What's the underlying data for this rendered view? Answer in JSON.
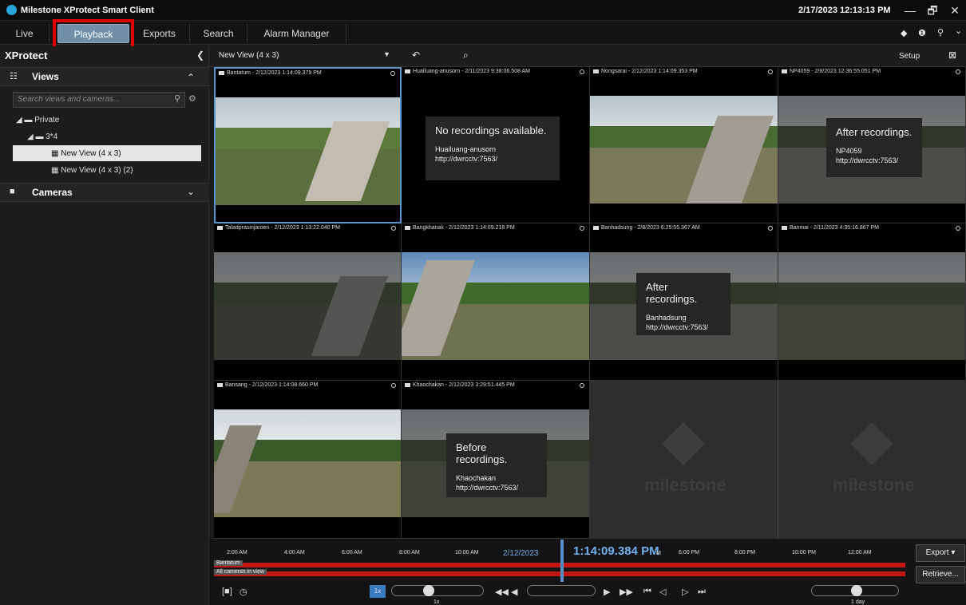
{
  "app": {
    "title": "Milestone XProtect Smart Client",
    "clock": "2/17/2023 12:13:13 PM",
    "win": [
      "—",
      "🗗",
      "✕"
    ]
  },
  "tabs": [
    "Live",
    "Playback",
    "Exports",
    "Search",
    "Alarm Manager"
  ],
  "header_icons": [
    "◆",
    "❶",
    "⚲",
    "⌄"
  ],
  "sidebar": {
    "title": "XProtect",
    "views_label": "Views",
    "search_placeholder": "Search views and cameras...",
    "tree": [
      "Private",
      "3*4",
      "New View (4 x 3)",
      "New View (4 x 3) (2)"
    ],
    "cameras_label": "Cameras"
  },
  "view_toolbar": {
    "view_name": "New View (4 x 3)",
    "setup": "Setup"
  },
  "tiles": [
    {
      "head": "Bantatum - 2/12/2023 1:14:09.379 PM"
    },
    {
      "head": "Huailuang-anusorn - 2/11/2023 9:38:06.508 AM",
      "msg": "No recordings available.",
      "name": "Huailuang-anusorn",
      "url": "http://dwrcctv:7563/"
    },
    {
      "head": "Nongsarai - 2/12/2023 1:14:09.353 PM"
    },
    {
      "head": "NP4059 - 2/8/2023 12:36:55.051 PM",
      "msg": "After recordings.",
      "name": "NP4059",
      "url": "http://dwrcctv:7563/"
    },
    {
      "head": "Taladprasinjaroen - 2/12/2023 1:13:22.040 PM"
    },
    {
      "head": "Bangkhanak - 2/12/2023 1:14:09.218 PM"
    },
    {
      "head": "Banhadsung - 2/8/2023 6:25:55.367 AM",
      "msg": "After recordings.",
      "name": "Banhadsung",
      "url": "http://dwrcctv:7563/"
    },
    {
      "head": "Banmai - 2/11/2023 4:35:16.867 PM"
    },
    {
      "head": "Bansang - 2/12/2023 1:14:08.660 PM"
    },
    {
      "head": "Khaochakan - 2/12/2023 3:29:51.445 PM",
      "msg": "Before recordings.",
      "name": "Khaochakan",
      "url": "http://dwrcctv:7563/"
    },
    {
      "logo": "milestone"
    },
    {
      "logo": "milestone"
    }
  ],
  "timeline": {
    "ticks": [
      "2:00 AM",
      "4:00 AM",
      "6:00 AM",
      "8:00 AM",
      "10:00 AM",
      "6:00 PM",
      "8:00 PM",
      "10:00 PM",
      "12:00 AM"
    ],
    "date": "2/12/2023",
    "current_time": "1:14:09.384 PM",
    "meridiem": "M",
    "track_camera": "Bantatum",
    "track_all": "All cameras in view",
    "speed": "1x",
    "speed_badge": "1x",
    "span": "1 day",
    "export": "Export ▾",
    "retrieve": "Retrieve..."
  }
}
